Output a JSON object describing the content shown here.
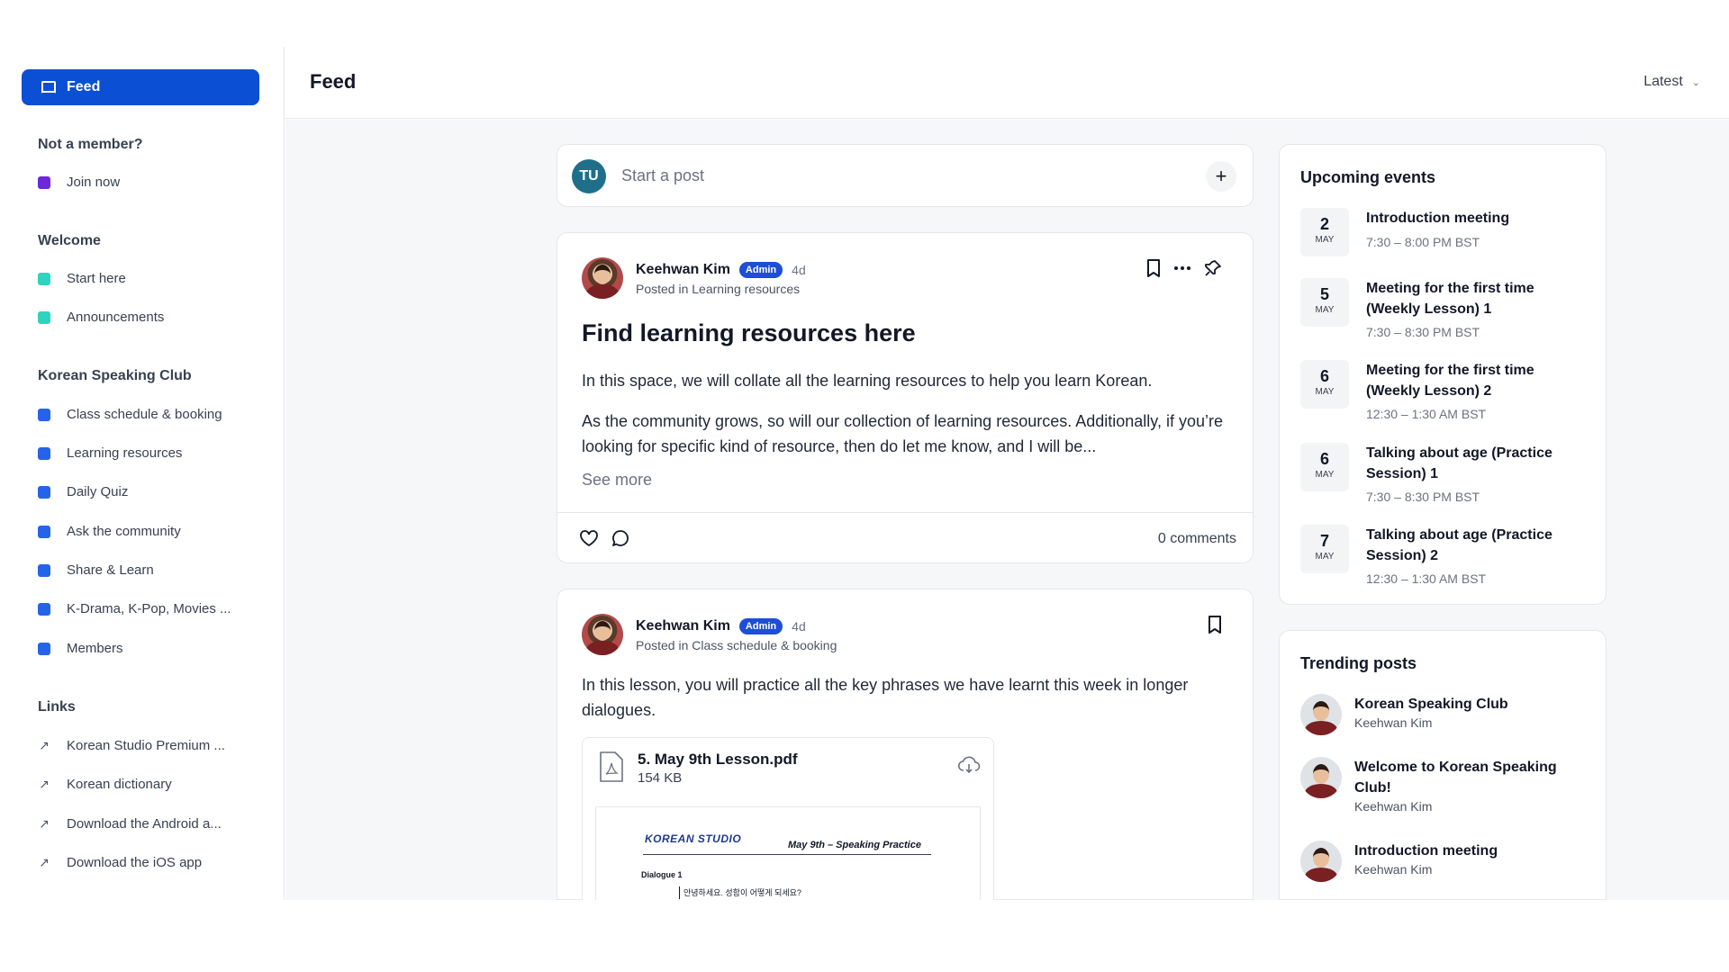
{
  "sidebar": {
    "feed_label": "Feed",
    "sections": [
      {
        "title": "Not a member?",
        "items": [
          {
            "label": "Join now",
            "color": "#6d28d9"
          }
        ]
      },
      {
        "title": "Welcome",
        "items": [
          {
            "label": "Start here",
            "color": "#2dd4bf"
          },
          {
            "label": "Announcements",
            "color": "#2dd4bf"
          }
        ]
      },
      {
        "title": "Korean Speaking Club",
        "items": [
          {
            "label": "Class schedule & booking",
            "color": "#2563eb"
          },
          {
            "label": "Learning resources",
            "color": "#2563eb"
          },
          {
            "label": "Daily Quiz",
            "color": "#2563eb"
          },
          {
            "label": "Ask the community",
            "color": "#2563eb"
          },
          {
            "label": "Share & Learn",
            "color": "#2563eb"
          },
          {
            "label": "K-Drama, K-Pop, Movies ...",
            "color": "#2563eb"
          },
          {
            "label": "Members",
            "color": "#2563eb"
          }
        ]
      },
      {
        "title": "Links",
        "items": [
          {
            "label": "Korean Studio Premium ...",
            "icon": "external-link-icon"
          },
          {
            "label": "Korean dictionary",
            "icon": "external-link-icon"
          },
          {
            "label": "Download the Android a...",
            "icon": "external-link-icon"
          },
          {
            "label": "Download the iOS app",
            "icon": "external-link-icon"
          }
        ]
      }
    ]
  },
  "header": {
    "title": "Feed",
    "sort_label": "Latest"
  },
  "composer": {
    "avatar_initials": "TU",
    "placeholder": "Start a post"
  },
  "posts": [
    {
      "author": "Keehwan Kim",
      "badge": "Admin",
      "ago": "4d",
      "posted_in": "Posted in Learning resources",
      "title": "Find learning resources here",
      "paragraphs": [
        "In this space, we will collate all the learning resources to help you learn Korean.",
        "As the community grows, so will our collection of learning resources. Additionally, if you’re looking for specific kind of resource, then do let me know, and I will be..."
      ],
      "see_more": "See more",
      "comments": "0 comments"
    },
    {
      "author": "Keehwan Kim",
      "badge": "Admin",
      "ago": "4d",
      "posted_in": "Posted in Class schedule & booking",
      "body": "In this lesson, you will practice all the key phrases we have learnt this week in longer dialogues.",
      "attachment": {
        "name": "5. May 9th Lesson.pdf",
        "size": "154 KB",
        "preview_brand": "KOREAN STUDIO",
        "preview_subtitle": "May 9th – Speaking Practice",
        "preview_section": "Dialogue 1",
        "preview_line": "안녕하세요. 성함이 어떻게 되세요?"
      }
    }
  ],
  "events": {
    "title": "Upcoming events",
    "items": [
      {
        "day": "2",
        "month": "MAY",
        "title": "Introduction meeting",
        "time": "7:30 – 8:00 PM BST"
      },
      {
        "day": "5",
        "month": "MAY",
        "title": "Meeting for the first time (Weekly Lesson) 1",
        "time": "7:30 – 8:30 PM BST"
      },
      {
        "day": "6",
        "month": "MAY",
        "title": "Meeting for the first time (Weekly Lesson) 2",
        "time": "12:30 – 1:30 AM BST"
      },
      {
        "day": "6",
        "month": "MAY",
        "title": "Talking about age (Practice Session) 1",
        "time": "7:30 – 8:30 PM BST"
      },
      {
        "day": "7",
        "month": "MAY",
        "title": "Talking about age (Practice Session) 2",
        "time": "12:30 – 1:30 AM BST"
      }
    ]
  },
  "trending": {
    "title": "Trending posts",
    "items": [
      {
        "title": "Korean Speaking Club",
        "author": "Keehwan Kim"
      },
      {
        "title": "Welcome to Korean Speaking Club!",
        "author": "Keehwan Kim"
      },
      {
        "title": "Introduction meeting",
        "author": "Keehwan Kim"
      }
    ]
  },
  "colors": {
    "accent": "#0a4fd4",
    "badge": "#1d4ed8"
  }
}
